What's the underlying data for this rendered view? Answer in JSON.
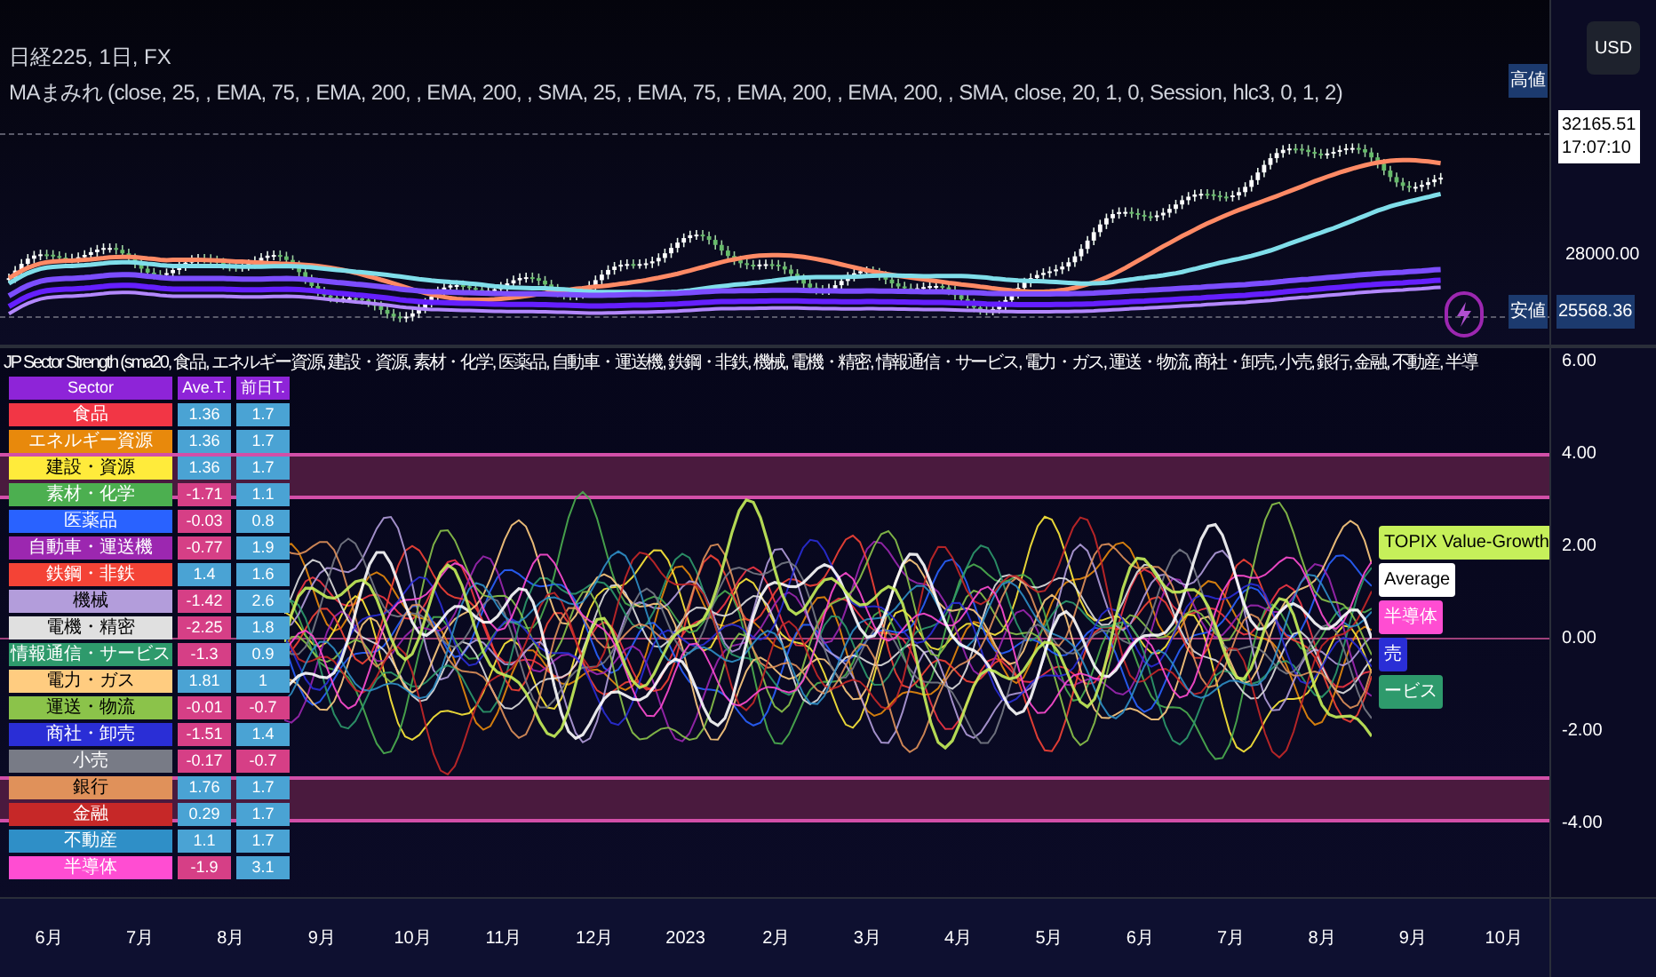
{
  "header": {
    "symbol": "日経225, 1日, FX",
    "indicator": "MAまみれ (close, 25, , EMA, 75, , EMA, 200, , EMA, 200, , SMA, 25, , EMA, 75, , EMA, 200, , EMA, 200, , SMA, close, 20, 1, 0, Session, hlc3, 0, 1, 2)"
  },
  "currency_button": "USD",
  "price_axis": {
    "high_tag": "高値",
    "last_price": "32165.51",
    "countdown": "17:07:10",
    "tick": "28000.00",
    "low_tag": "安値",
    "low_price": "25568.36"
  },
  "strength_pane": {
    "title": "JP Sector Strength (sma20, 食品, エネルギー資源, 建設・資源, 素材・化学, 医薬品, 自動車・運送機, 鉄鋼・非鉄, 機械, 電機・精密, 情報通信・サービス, 電力・ガス, 運送・物流, 商社・卸売, 小売, 銀行, 金融, 不動産, 半導",
    "axis_ticks": [
      "6.00",
      "4.00",
      "2.00",
      "0.00",
      "-2.00",
      "-4.00"
    ],
    "table": {
      "columns": [
        "Sector",
        "Ave.T.",
        "前日T."
      ],
      "rows": [
        {
          "sector": "食品",
          "color": "#f23645",
          "ave": {
            "text": "1.36",
            "color": "#4aa3d4"
          },
          "prev": {
            "text": "1.7",
            "color": "#4aa3d4"
          }
        },
        {
          "sector": "エネルギー資源",
          "color": "#e8890c",
          "ave": {
            "text": "1.36",
            "color": "#4aa3d4"
          },
          "prev": {
            "text": "1.7",
            "color": "#4aa3d4"
          }
        },
        {
          "sector": "建設・資源",
          "color": "#ffeb3b",
          "ave": {
            "text": "1.36",
            "color": "#4aa3d4"
          },
          "prev": {
            "text": "1.7",
            "color": "#4aa3d4"
          }
        },
        {
          "sector": "素材・化学",
          "color": "#4caf50",
          "ave": {
            "text": "-1.71",
            "color": "#d63f86"
          },
          "prev": {
            "text": "1.1",
            "color": "#4aa3d4"
          }
        },
        {
          "sector": "医薬品",
          "color": "#2962ff",
          "ave": {
            "text": "-0.03",
            "color": "#d63f86"
          },
          "prev": {
            "text": "0.8",
            "color": "#4aa3d4"
          }
        },
        {
          "sector": "自動車・運送機",
          "color": "#9c27b0",
          "ave": {
            "text": "-0.77",
            "color": "#d63f86"
          },
          "prev": {
            "text": "1.9",
            "color": "#4aa3d4"
          }
        },
        {
          "sector": "鉄鋼・非鉄",
          "color": "#f44336",
          "ave": {
            "text": "1.4",
            "color": "#4aa3d4"
          },
          "prev": {
            "text": "1.6",
            "color": "#4aa3d4"
          }
        },
        {
          "sector": "機械",
          "color": "#b39ddb",
          "ave": {
            "text": "-1.42",
            "color": "#d63f86"
          },
          "prev": {
            "text": "2.6",
            "color": "#4aa3d4"
          }
        },
        {
          "sector": "電機・精密",
          "color": "#e0e0e0",
          "ave": {
            "text": "-2.25",
            "color": "#d63f86"
          },
          "prev": {
            "text": "1.8",
            "color": "#4aa3d4"
          }
        },
        {
          "sector": "情報通信・サービス",
          "color": "#2e9a6c",
          "ave": {
            "text": "-1.3",
            "color": "#d63f86"
          },
          "prev": {
            "text": "0.9",
            "color": "#4aa3d4"
          }
        },
        {
          "sector": "電力・ガス",
          "color": "#ffcc80",
          "ave": {
            "text": "1.81",
            "color": "#4aa3d4"
          },
          "prev": {
            "text": "1",
            "color": "#4aa3d4"
          }
        },
        {
          "sector": "運送・物流",
          "color": "#8bc34a",
          "ave": {
            "text": "-0.01",
            "color": "#d63f86"
          },
          "prev": {
            "text": "-0.7",
            "color": "#d63f86"
          }
        },
        {
          "sector": "商社・卸売",
          "color": "#2a2ed6",
          "ave": {
            "text": "-1.51",
            "color": "#d63f86"
          },
          "prev": {
            "text": "1.4",
            "color": "#4aa3d4"
          }
        },
        {
          "sector": "小売",
          "color": "#787b86",
          "ave": {
            "text": "-0.17",
            "color": "#d63f86"
          },
          "prev": {
            "text": "-0.7",
            "color": "#d63f86"
          }
        },
        {
          "sector": "銀行",
          "color": "#e0915a",
          "ave": {
            "text": "1.76",
            "color": "#4aa3d4"
          },
          "prev": {
            "text": "1.7",
            "color": "#4aa3d4"
          }
        },
        {
          "sector": "金融",
          "color": "#c62828",
          "ave": {
            "text": "0.29",
            "color": "#4aa3d4"
          },
          "prev": {
            "text": "1.7",
            "color": "#4aa3d4"
          }
        },
        {
          "sector": "不動産",
          "color": "#2f8fc7",
          "ave": {
            "text": "1.1",
            "color": "#4aa3d4"
          },
          "prev": {
            "text": "1.7",
            "color": "#4aa3d4"
          }
        },
        {
          "sector": "半導体",
          "color": "#ff4dd2",
          "ave": {
            "text": "-1.9",
            "color": "#d63f86"
          },
          "prev": {
            "text": "3.1",
            "color": "#4aa3d4"
          }
        }
      ]
    },
    "end_labels": [
      {
        "text": "TOPIX Value-Growth",
        "color": "#c6f05a"
      },
      {
        "text": "Average",
        "color": "#ffffff"
      },
      {
        "text": "半導体",
        "color": "#ff4dd2"
      },
      {
        "text": "売",
        "color": "#2a2ed6"
      },
      {
        "text": "ービス",
        "color": "#2e9a6c"
      }
    ]
  },
  "time_axis": [
    "6月",
    "7月",
    "8月",
    "9月",
    "10月",
    "11月",
    "12月",
    "2023",
    "2月",
    "3月",
    "4月",
    "5月",
    "6月",
    "7月",
    "8月",
    "9月",
    "10月"
  ]
}
